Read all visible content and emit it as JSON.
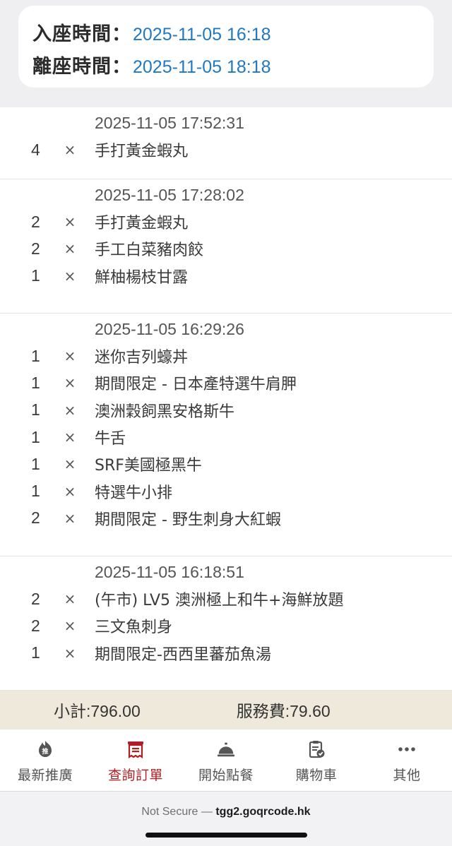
{
  "session": {
    "checkin_label": "入座時間：",
    "checkin_value": "2025-11-05 16:18",
    "checkout_label": "離座時間：",
    "checkout_value": "2025-11-05 18:18"
  },
  "orders": [
    {
      "timestamp": "2025-11-05 17:52:31",
      "items": [
        {
          "qty": "4",
          "x": "×",
          "name": "手打黃金蝦丸"
        }
      ]
    },
    {
      "timestamp": "2025-11-05 17:28:02",
      "items": [
        {
          "qty": "2",
          "x": "×",
          "name": "手打黃金蝦丸"
        },
        {
          "qty": "2",
          "x": "×",
          "name": "手工白菜豬肉餃"
        },
        {
          "qty": "1",
          "x": "×",
          "name": "鮮柚楊枝甘露"
        }
      ]
    },
    {
      "timestamp": "2025-11-05 16:29:26",
      "items": [
        {
          "qty": "1",
          "x": "×",
          "name": "迷你吉列蠔丼"
        },
        {
          "qty": "1",
          "x": "×",
          "name": "期間限定 - 日本產特選牛肩胛"
        },
        {
          "qty": "1",
          "x": "×",
          "name": "澳洲穀飼黑安格斯牛"
        },
        {
          "qty": "1",
          "x": "×",
          "name": "牛舌"
        },
        {
          "qty": "1",
          "x": "×",
          "name": "SRF美國極黑牛"
        },
        {
          "qty": "1",
          "x": "×",
          "name": "特選牛小排"
        },
        {
          "qty": "2",
          "x": "×",
          "name": "期間限定 - 野生刺身大紅蝦"
        }
      ]
    },
    {
      "timestamp": "2025-11-05 16:18:51",
      "items": [
        {
          "qty": "2",
          "x": "×",
          "name": "(午市) LV5 澳洲極上和牛+海鮮放題"
        },
        {
          "qty": "2",
          "x": "×",
          "name": "三文魚刺身"
        },
        {
          "qty": "1",
          "x": "×",
          "name": "期間限定-西西里蕃茄魚湯"
        }
      ]
    }
  ],
  "summary": {
    "subtotal": "小計:796.00",
    "service": "服務費:79.60"
  },
  "tabbar": {
    "items": [
      {
        "label": "最新推廣",
        "icon": "recommend-badge-icon",
        "active": false
      },
      {
        "label": "查詢訂單",
        "icon": "order-receipt-icon",
        "active": true
      },
      {
        "label": "開始點餐",
        "icon": "service-bell-icon",
        "active": false
      },
      {
        "label": "購物車",
        "icon": "checklist-clipboard-icon",
        "active": false
      },
      {
        "label": "其他",
        "icon": "more-dots-icon",
        "active": false
      }
    ]
  },
  "browser": {
    "security": "Not Secure —",
    "host": "tgg2.goqrcode.hk"
  },
  "colors": {
    "accent": "#1f78c2",
    "active_tab": "#b01e23",
    "summary_bg": "#efe9dc"
  }
}
